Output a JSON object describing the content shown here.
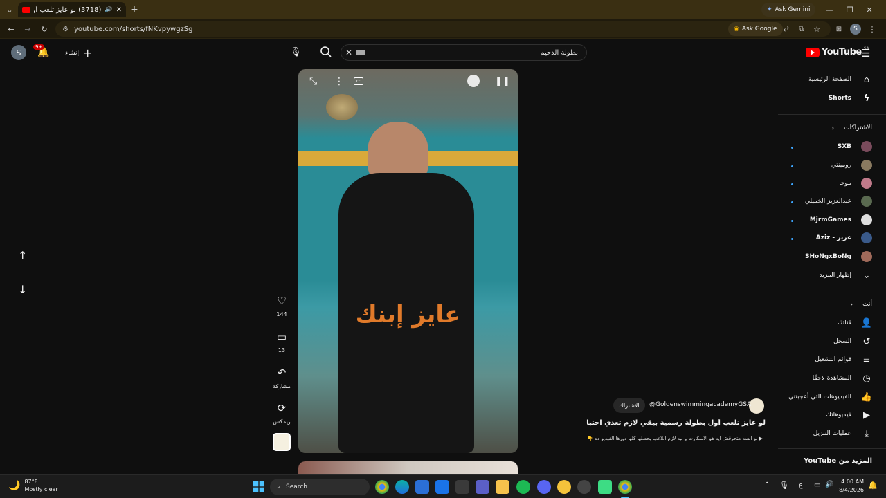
{
  "browser": {
    "tab_title": "(3718) لو عايز تلعب أول بطو...",
    "url": "youtube.com/shorts/fNKvpywgzSg",
    "ask_gemini": "Ask Gemini",
    "ask_google": "Ask Google",
    "profile_letter": "S"
  },
  "youtube": {
    "logo_text": "YouTube",
    "logo_country": "SA",
    "search_value": "بطولة الدحيم",
    "create_label": "إنشاء",
    "notif_count": "9+",
    "avatar_letter": "S"
  },
  "sidebar": {
    "home": "الصفحة الرئيسية",
    "shorts": "Shorts",
    "subscriptions_header": "الاشتراكات",
    "subscriptions": [
      {
        "name": "SXB",
        "color": "#7a4b5c"
      },
      {
        "name": "رومينتي",
        "color": "#8a7a60"
      },
      {
        "name": "موحا",
        "color": "#c07a8a"
      },
      {
        "name": "عبدالعزيز الخميلي",
        "color": "#5a6a50"
      },
      {
        "name": "MjrmGames",
        "color": "#dddddd"
      },
      {
        "name": "Aziz - عزيز",
        "color": "#3a5a8a"
      },
      {
        "name": "SHoNgxBoNg",
        "color": "#a06a5a"
      }
    ],
    "show_more": "إظهار المزيد",
    "you_header": "أنت",
    "you_items": [
      {
        "label": "قناتك",
        "icon": "channel-icon"
      },
      {
        "label": "السجل",
        "icon": "history-icon"
      },
      {
        "label": "قوائم التشغيل",
        "icon": "playlists-icon"
      },
      {
        "label": "المشاهدة لاحقًا",
        "icon": "watch-later-icon"
      },
      {
        "label": "الفيديوهات التي أعجبتني",
        "icon": "liked-icon"
      },
      {
        "label": "فيديوهاتك",
        "icon": "your-videos-icon"
      },
      {
        "label": "عمليات التنزيل",
        "icon": "downloads-icon"
      }
    ],
    "more_from": "المزيد من YouTube"
  },
  "short": {
    "overlay_text": "عايز إبنك",
    "likes": "144",
    "comments": "13",
    "share": "مشاركة",
    "remix": "ريمكس",
    "channel": "@GoldenswimmingacademyGSA",
    "subscribe": "الاشتراك",
    "title": "لو عايز تلعب أول بطولة رسمية بيقي لازم تعدي اختبارات ...",
    "description": "▶ لو انسه متحرقش ايه هو الاسكارت و ليه لازم اللاعب يحصلها كلها دورها الفيديو ده 👇"
  },
  "taskbar": {
    "weather_temp": "87°F",
    "weather_desc": "Mostly clear",
    "search_label": "Search",
    "time": "4:00 AM",
    "date": "8/4/2026",
    "lang": "ع"
  }
}
